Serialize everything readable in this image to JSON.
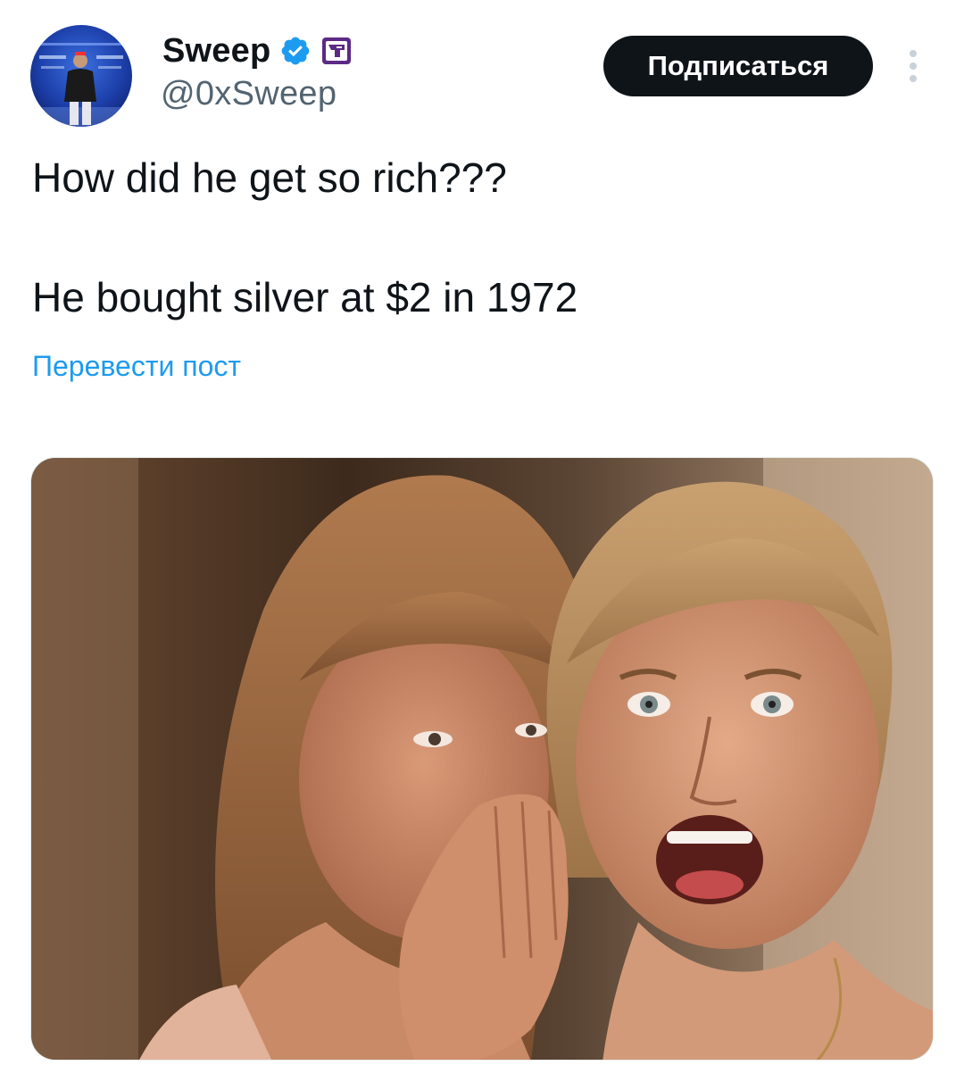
{
  "author": {
    "display_name": "Sweep",
    "handle": "@0xSweep",
    "verified": true,
    "avatar_icon": "avatar-photo"
  },
  "actions": {
    "follow_label": "Подписаться",
    "more_icon": "more-vertical-icon"
  },
  "tweet": {
    "line1": "How did he get so rich???",
    "line2": "He bought silver at $2 in 1972",
    "translate_label": "Перевести пост"
  },
  "media": {
    "type": "photo",
    "alt": ""
  },
  "colors": {
    "accent": "#1d9bf0",
    "text_primary": "#0f1419",
    "text_secondary": "#536471",
    "follow_bg": "#0f1419"
  }
}
